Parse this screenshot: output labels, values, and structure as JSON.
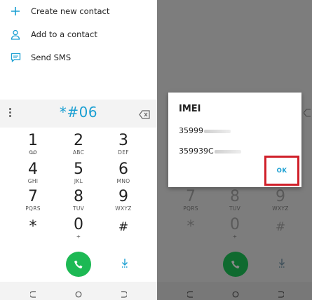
{
  "left": {
    "actions": [
      {
        "label": "Create new contact",
        "icon": "plus-icon"
      },
      {
        "label": "Add to a contact",
        "icon": "person-icon"
      },
      {
        "label": "Send SMS",
        "icon": "sms-icon"
      }
    ],
    "dialed_number": "*#06",
    "keys": [
      {
        "digit": "1",
        "sub": "voicemail-icon"
      },
      {
        "digit": "2",
        "sub": "ABC"
      },
      {
        "digit": "3",
        "sub": "DEF"
      },
      {
        "digit": "4",
        "sub": "GHI"
      },
      {
        "digit": "5",
        "sub": "JKL"
      },
      {
        "digit": "6",
        "sub": "MNO"
      },
      {
        "digit": "7",
        "sub": "PQRS"
      },
      {
        "digit": "8",
        "sub": "TUV"
      },
      {
        "digit": "9",
        "sub": "WXYZ"
      },
      {
        "digit": "*",
        "sub": ""
      },
      {
        "digit": "0",
        "sub": "+"
      },
      {
        "digit": "#",
        "sub": ""
      }
    ]
  },
  "dialog": {
    "title": "IMEI",
    "imei_1": "35999",
    "imei_2": "359939C",
    "ok_label": "OK"
  },
  "colors": {
    "accent": "#1a9fd2",
    "call_green_left": "#1db954",
    "call_green_right": "#0f6a2f",
    "overlay": "#7d7d7d",
    "highlight": "#d0202a"
  }
}
